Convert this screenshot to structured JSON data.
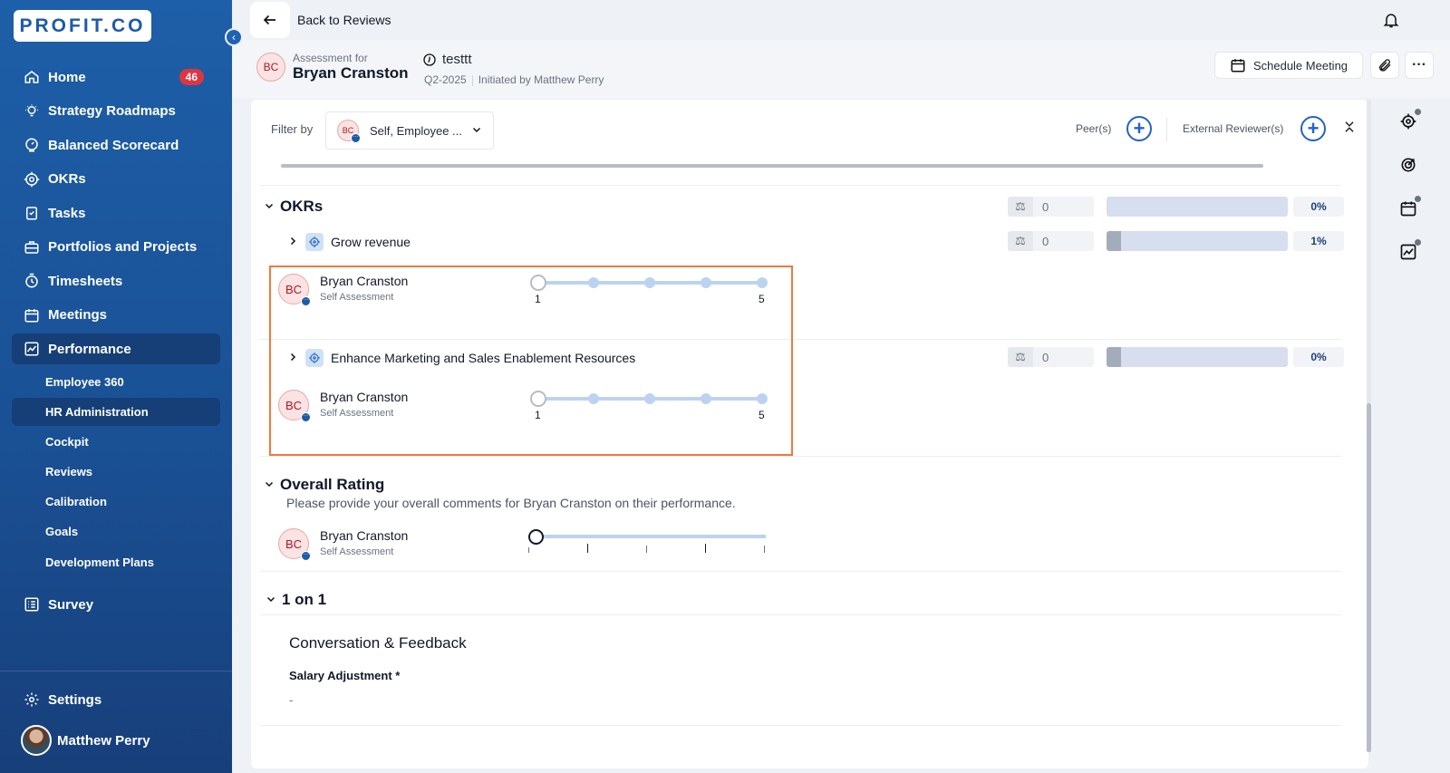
{
  "brand": {
    "logo_text": "PROFIT.CO",
    "accent": "#1e5aa8",
    "highlight_color": "#f0793e"
  },
  "sidebar": {
    "items": [
      {
        "label": "Home",
        "icon": "home-icon",
        "badge": "46"
      },
      {
        "label": "Strategy Roadmaps",
        "icon": "lightbulb-icon"
      },
      {
        "label": "Balanced Scorecard",
        "icon": "scorecard-icon"
      },
      {
        "label": "OKRs",
        "icon": "target-icon"
      },
      {
        "label": "Tasks",
        "icon": "task-icon"
      },
      {
        "label": "Portfolios and Projects",
        "icon": "briefcase-icon"
      },
      {
        "label": "Timesheets",
        "icon": "clock-icon"
      },
      {
        "label": "Meetings",
        "icon": "calendar-icon"
      },
      {
        "label": "Performance",
        "icon": "chart-icon",
        "active": true
      }
    ],
    "sub_items": [
      {
        "label": "Employee 360"
      },
      {
        "label": "HR Administration",
        "active": true
      },
      {
        "label": "Cockpit"
      },
      {
        "label": "Reviews"
      },
      {
        "label": "Calibration"
      },
      {
        "label": "Goals"
      },
      {
        "label": "Development Plans"
      }
    ],
    "survey": "Survey",
    "settings": "Settings",
    "user_name": "Matthew Perry"
  },
  "topbar": {
    "back_label": "Back to Reviews"
  },
  "header": {
    "avatar_initials": "BC",
    "assessment_for_label": "Assessment for",
    "employee_name": "Bryan Cranston",
    "cycle_name": "testtt",
    "period": "Q2-2025",
    "initiated_by": "Initiated by Matthew Perry",
    "schedule_meeting": "Schedule Meeting"
  },
  "filter": {
    "label": "Filter by",
    "selected": "Self, Employee ...",
    "avatar_initials": "BC",
    "peers_label": "Peer(s)",
    "external_label": "External Reviewer(s)"
  },
  "okrs": {
    "title": "OKRs",
    "weight": "0",
    "progress_pct": "0%",
    "progress_fraction": 0,
    "objectives": [
      {
        "name": "Grow revenue",
        "weight": "0",
        "progress_pct": "1%",
        "progress_fraction": 0.08,
        "rater": {
          "initials": "BC",
          "name": "Bryan Cranston",
          "type": "Self Assessment"
        },
        "scale_min": "1",
        "scale_max": "5"
      },
      {
        "name": "Enhance Marketing and Sales Enablement Resources",
        "weight": "0",
        "progress_pct": "0%",
        "progress_fraction": 0.08,
        "rater": {
          "initials": "BC",
          "name": "Bryan Cranston",
          "type": "Self Assessment"
        },
        "scale_min": "1",
        "scale_max": "5"
      }
    ]
  },
  "overall": {
    "title": "Overall Rating",
    "description": "Please provide your overall comments for Bryan Cranston on their performance.",
    "rater": {
      "initials": "BC",
      "name": "Bryan Cranston",
      "type": "Self Assessment"
    }
  },
  "one_on_one": {
    "title": "1 on 1",
    "conversation_title": "Conversation & Feedback",
    "salary_label": "Salary Adjustment *",
    "salary_value": "-"
  }
}
